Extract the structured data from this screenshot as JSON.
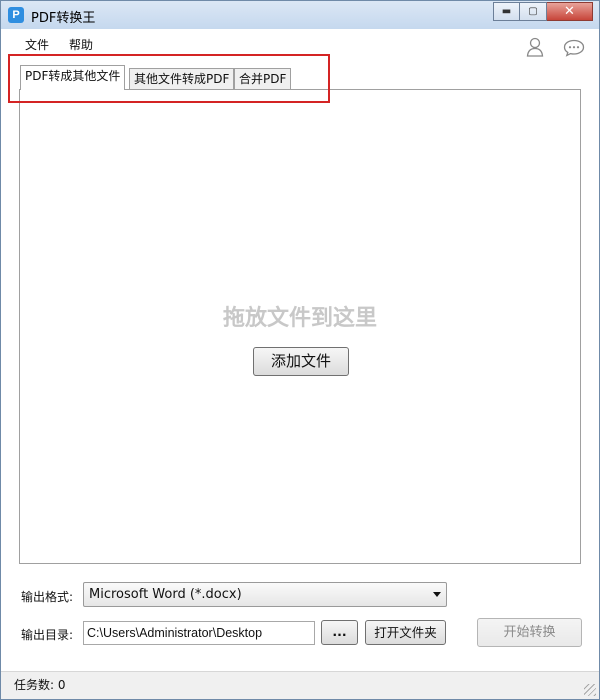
{
  "window": {
    "title": "PDF转换王",
    "icon_letter": "P",
    "minimize_glyph": "▬",
    "maximize_glyph": "▢",
    "close_glyph": "✕"
  },
  "menu": {
    "file": "文件",
    "help": "帮助"
  },
  "header_icons": [
    "user-icon",
    "chat-icon"
  ],
  "tabs": [
    {
      "label": "PDF转成其他文件",
      "active": true
    },
    {
      "label": "其他文件转成PDF",
      "active": false
    },
    {
      "label": "合并PDF",
      "active": false
    }
  ],
  "drop_area": {
    "hint": "拖放文件到这里",
    "add_button": "添加文件"
  },
  "output": {
    "format_label": "输出格式:",
    "format_value": "Microsoft Word (*.docx)",
    "dir_label": "输出目录:",
    "dir_value": "C:\\Users\\Administrator\\Desktop",
    "browse_button": "...",
    "open_folder_button": "打开文件夹",
    "start_button": "开始转换"
  },
  "status": {
    "task_count_text": "任务数: 0"
  },
  "colors": {
    "highlight": "#d42424",
    "app_icon": "#2f8ee0",
    "hint_text": "#c8c8c8"
  }
}
